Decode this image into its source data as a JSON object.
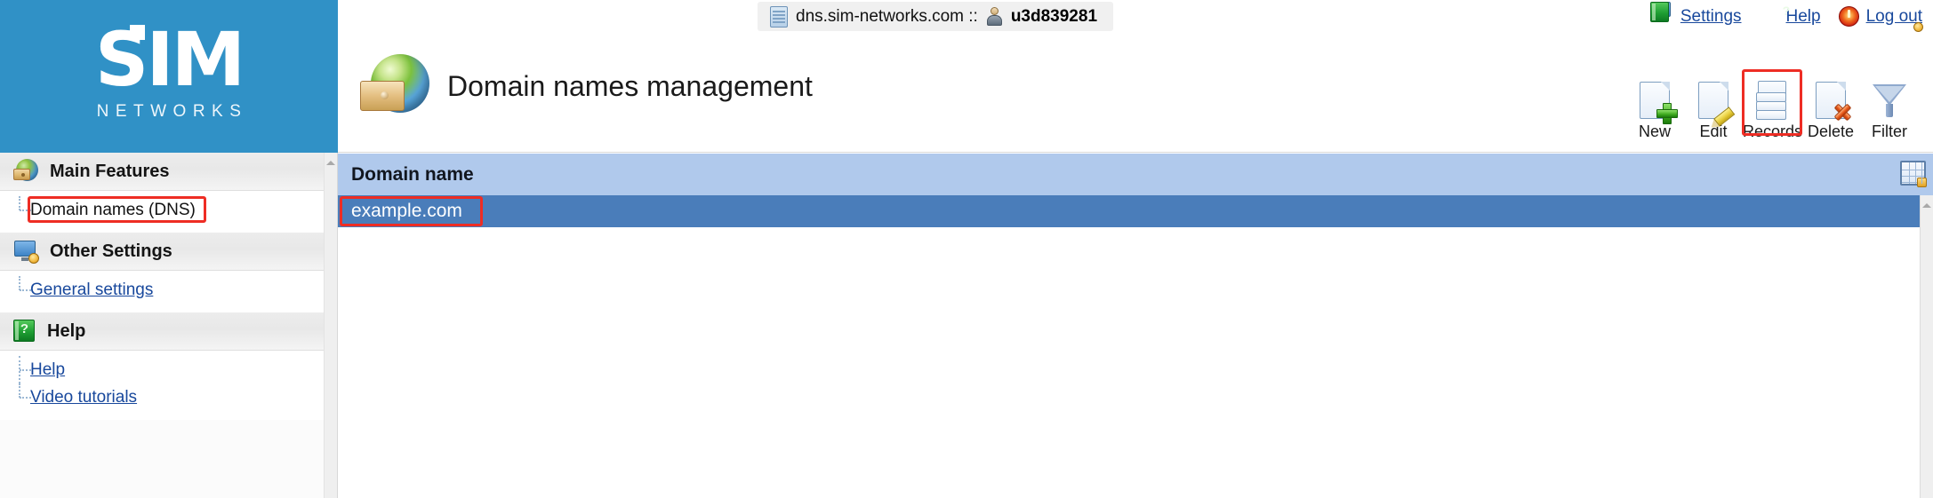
{
  "brand": {
    "name": "SIM",
    "tagline": "NETWORKS"
  },
  "header": {
    "server_icon": "server-rack-icon",
    "host": "dns.sim-networks.com ::",
    "user_icon": "user-avatar-icon",
    "username": "u3d839281",
    "links": [
      {
        "label": "Settings",
        "icon": "monitor-gear-icon"
      },
      {
        "label": "Help",
        "icon": "green-book-question-icon"
      },
      {
        "label": "Log out",
        "icon": "power-button-icon"
      }
    ]
  },
  "page": {
    "title": "Domain names management",
    "title_icon": "globe-drawer-icon"
  },
  "toolbar": {
    "buttons": [
      {
        "label": "New",
        "icon": "document-plus-icon",
        "highlighted": false
      },
      {
        "label": "Edit",
        "icon": "document-pencil-icon",
        "highlighted": false
      },
      {
        "label": "Records",
        "icon": "document-stack-icon",
        "highlighted": true
      },
      {
        "label": "Delete",
        "icon": "document-delete-icon",
        "highlighted": false
      },
      {
        "label": "Filter",
        "icon": "funnel-icon",
        "highlighted": false
      }
    ]
  },
  "sidebar": {
    "sections": [
      {
        "title": "Main Features",
        "icon": "globe-drawer-icon",
        "items": [
          {
            "label": "Domain names (DNS)",
            "active": true,
            "highlighted": true
          }
        ]
      },
      {
        "title": "Other Settings",
        "icon": "monitor-gear-icon",
        "items": [
          {
            "label": "General settings",
            "active": false,
            "highlighted": false
          }
        ]
      },
      {
        "title": "Help",
        "icon": "green-book-question-icon",
        "items": [
          {
            "label": "Help",
            "active": false,
            "highlighted": false
          },
          {
            "label": "Video tutorials",
            "active": false,
            "highlighted": false
          }
        ]
      }
    ]
  },
  "grid": {
    "columns": [
      "Domain name"
    ],
    "column_config_icon": "grid-settings-icon",
    "rows": [
      {
        "domain": "example.com",
        "selected": true,
        "highlighted": true
      }
    ]
  },
  "colors": {
    "brand_blue": "#3091c6",
    "grid_header": "#b0c9ec",
    "row_selected": "#4a7dba",
    "link_blue": "#18489c",
    "highlight_red": "#ee2d24"
  }
}
